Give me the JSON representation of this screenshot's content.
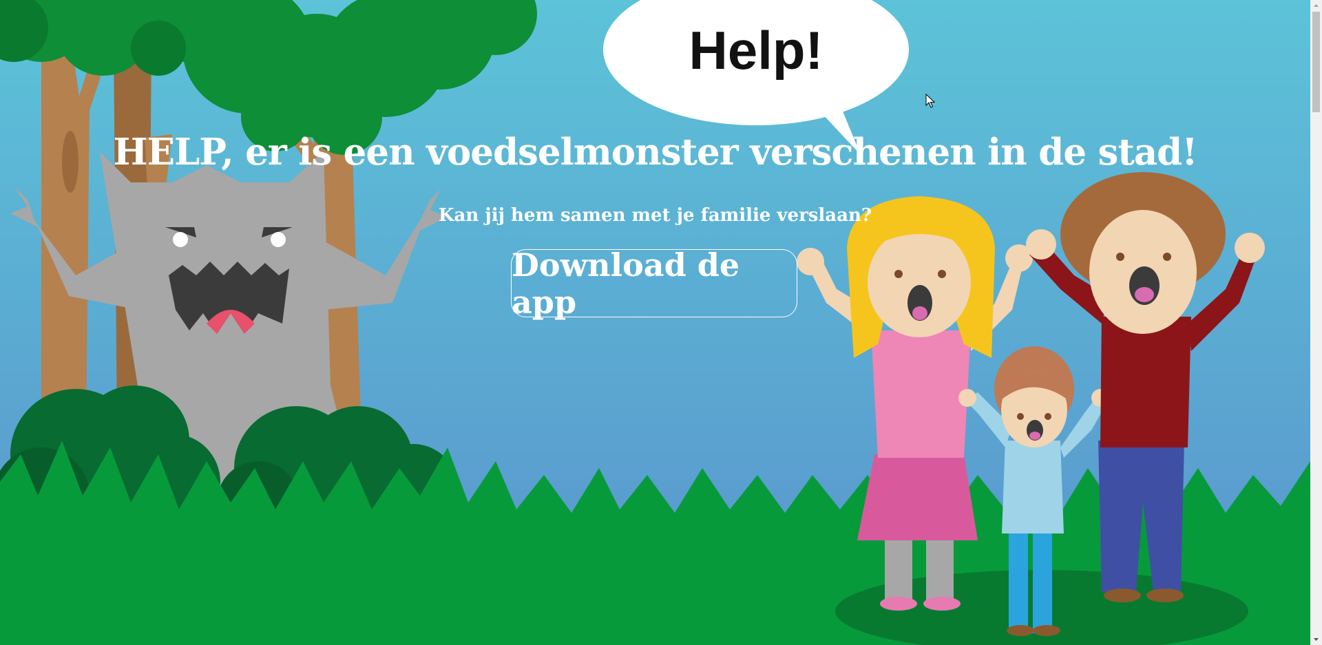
{
  "speech_bubble": {
    "text": "Help!"
  },
  "hero": {
    "title": "HELP, er is een voedselmonster verschenen in de stad!",
    "subtitle": "Kan jij hem samen met je familie verslaan?",
    "cta_label": "Download de app"
  },
  "icons": {
    "cursor": "mouse-pointer-icon",
    "scroll_up": "scroll-up-arrow-icon",
    "scroll_down": "scroll-down-arrow-icon"
  },
  "colors": {
    "sky_top": "#5cc3d8",
    "sky_bottom": "#5b9ccf",
    "grass": "#079a3b",
    "tree_foliage": "#0d8e37",
    "monster": "#a7a7a7",
    "text": "#ffffff"
  }
}
